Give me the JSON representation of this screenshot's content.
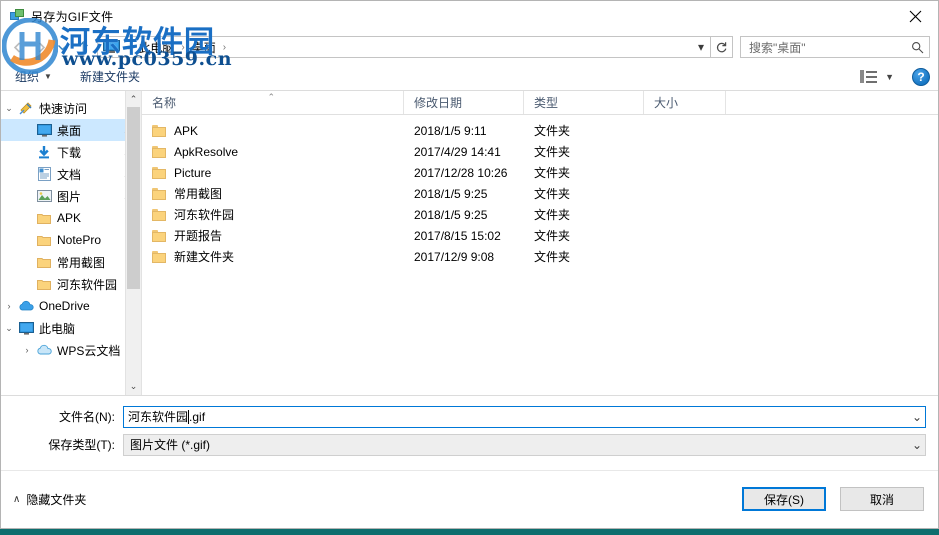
{
  "window": {
    "title": "另存为GIF文件",
    "close_label": "✕",
    "title_icon": "gif-file-icon"
  },
  "address": {
    "back_icon": "back-arrow-icon",
    "forward_icon": "forward-arrow-icon",
    "recent_icon": "recent-locations-chevron-icon",
    "up_icon": "up-arrow-icon",
    "computer_icon": "this-pc-icon",
    "crumbs": [
      {
        "label": "此电脑"
      },
      {
        "label": "桌面"
      }
    ],
    "separator": "›",
    "dropdown_icon": "▾",
    "refresh_icon": "↻"
  },
  "search": {
    "placeholder": "搜索\"桌面\"",
    "icon": "search-magnifier-icon"
  },
  "toolbar": {
    "organize_label": "组织",
    "organize_caret": "▼",
    "new_folder_label": "新建文件夹",
    "view_caret": "▼",
    "help_label": "?"
  },
  "nav": {
    "items": [
      {
        "label": "快速访问",
        "chev": "⌄",
        "icon": "pin-star-icon",
        "pin": "",
        "indent": 0,
        "selected": false
      },
      {
        "label": "桌面",
        "chev": "",
        "icon": "desktop-icon",
        "pin": "📌",
        "indent": 1,
        "selected": true
      },
      {
        "label": "下载",
        "chev": "",
        "icon": "downloads-icon",
        "pin": "📌",
        "indent": 1,
        "selected": false
      },
      {
        "label": "文档",
        "chev": "",
        "icon": "documents-icon",
        "pin": "📌",
        "indent": 1,
        "selected": false
      },
      {
        "label": "图片",
        "chev": "",
        "icon": "pictures-icon",
        "pin": "📌",
        "indent": 1,
        "selected": false
      },
      {
        "label": "APK",
        "chev": "",
        "icon": "folder-icon",
        "pin": "",
        "indent": 1,
        "selected": false
      },
      {
        "label": "NotePro",
        "chev": "",
        "icon": "folder-icon",
        "pin": "",
        "indent": 1,
        "selected": false
      },
      {
        "label": "常用截图",
        "chev": "",
        "icon": "folder-icon",
        "pin": "",
        "indent": 1,
        "selected": false
      },
      {
        "label": "河东软件园",
        "chev": "",
        "icon": "folder-icon",
        "pin": "",
        "indent": 1,
        "selected": false
      },
      {
        "label": "OneDrive",
        "chev": "›",
        "icon": "onedrive-cloud-icon",
        "pin": "",
        "indent": 0,
        "selected": false
      },
      {
        "label": "此电脑",
        "chev": "⌄",
        "icon": "this-pc-icon",
        "pin": "",
        "indent": 0,
        "selected": false
      },
      {
        "label": "WPS云文档",
        "chev": "›",
        "icon": "wps-cloud-icon",
        "pin": "",
        "indent": 1,
        "selected": false
      }
    ],
    "scroll_up_icon": "⌃",
    "scroll_down_icon": "⌄"
  },
  "filelist": {
    "columns": [
      {
        "label": "名称",
        "key": "name"
      },
      {
        "label": "修改日期",
        "key": "date"
      },
      {
        "label": "类型",
        "key": "type"
      },
      {
        "label": "大小",
        "key": "size"
      }
    ],
    "sort_indicator": "⌃",
    "rows": [
      {
        "name": "APK",
        "date": "2018/1/5 9:11",
        "type": "文件夹",
        "size": ""
      },
      {
        "name": "ApkResolve",
        "date": "2017/4/29 14:41",
        "type": "文件夹",
        "size": ""
      },
      {
        "name": "Picture",
        "date": "2017/12/28 10:26",
        "type": "文件夹",
        "size": ""
      },
      {
        "name": "常用截图",
        "date": "2018/1/5 9:25",
        "type": "文件夹",
        "size": ""
      },
      {
        "name": "河东软件园",
        "date": "2018/1/5 9:25",
        "type": "文件夹",
        "size": ""
      },
      {
        "name": "开题报告",
        "date": "2017/8/15 15:02",
        "type": "文件夹",
        "size": ""
      },
      {
        "name": "新建文件夹",
        "date": "2017/12/9 9:08",
        "type": "文件夹",
        "size": ""
      }
    ]
  },
  "form": {
    "filename_label": "文件名(N):",
    "filename_value": "河东软件园",
    "filename_ext": ".gif",
    "savetype_label": "保存类型(T):",
    "savetype_value": "图片文件 (*.gif)",
    "dropdown_icon": "⌄"
  },
  "footer": {
    "hide_folders_label": "隐藏文件夹",
    "hide_folders_caret": "∧",
    "save_label": "保存(S)",
    "cancel_label": "取消"
  },
  "watermark": {
    "text": "河东软件园",
    "url": "www.pc0359.cn"
  },
  "colors": {
    "accent": "#0078d7",
    "selection": "#cce8ff",
    "watermark_blue": "#1a6fc4"
  }
}
